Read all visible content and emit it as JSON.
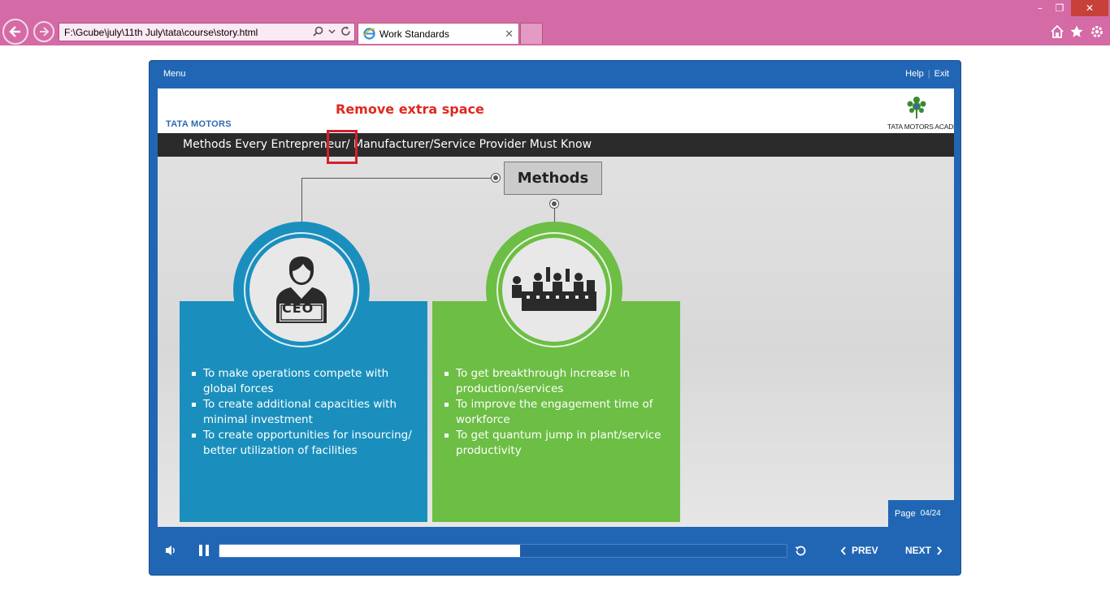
{
  "browser": {
    "address": "F:\\Gcube\\july\\11th July\\tata\\course\\story.html",
    "tab_title": "Work Standards",
    "tab_close": "✕",
    "win_minimize": "–",
    "win_restore": "❐",
    "win_close": "✕"
  },
  "player": {
    "menu_label": "Menu",
    "help_label": "Help",
    "help_sep": "|",
    "exit_label": "Exit"
  },
  "slide": {
    "brand": "TATA MOTORS",
    "review_note": "Remove extra space",
    "academy": "TATA MOTORS ACADEMY",
    "title": "Methods Every Entrepreneur/ Manufacturer/Service Provider Must Know",
    "center_label": "Methods",
    "ceo_badge": "CEO",
    "left_points": [
      "To make operations compete with global forces",
      "To create additional capacities with minimal investment",
      "To create opportunities for insourcing/ better utilization of facilities"
    ],
    "right_points": [
      "To get breakthrough increase in production/services",
      "To improve the engagement time of workforce",
      "To get quantum jump in plant/service productivity"
    ],
    "page_label": "Page",
    "page_number": "04/24"
  },
  "controls": {
    "progress_fraction": 0.53,
    "prev_label": "PREV",
    "next_label": "NEXT"
  },
  "colors": {
    "chrome": "#d46aa6",
    "player": "#2166b4",
    "blue_card": "#1a8fbd",
    "green_card": "#6cbe44",
    "note_red": "#e0281f"
  }
}
